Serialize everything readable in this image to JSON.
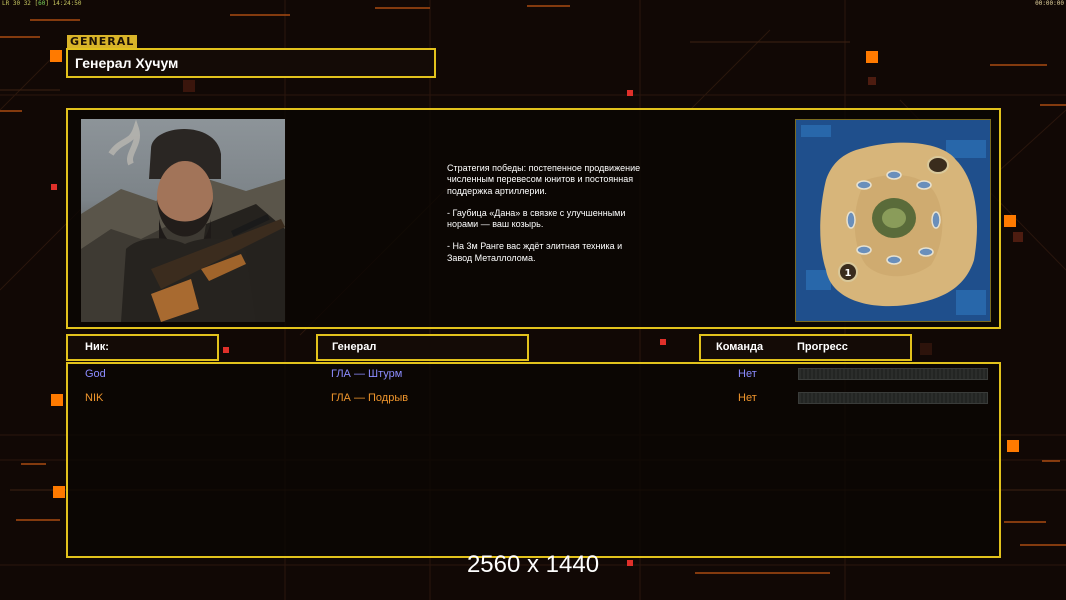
{
  "status_bar": {
    "left_prefix": "LR",
    "left_values": "30 32",
    "fps": "60",
    "clock": "14:24:50",
    "right_time": "00:00:00"
  },
  "general_tag": "GENERAL",
  "title": "Генерал Хучум",
  "briefing": {
    "paragraphs": [
      "Стратегия победы: постепенное продвижение численным перевесом юнитов и постоянная поддержка артиллерии.",
      "- Гаубица «Дана» в связке с улучшенными норами — ваш козырь.",
      "- На 3м Ранге вас ждёт элитная техника и Завод Металлолома."
    ]
  },
  "map": {
    "start_positions": [
      "1"
    ]
  },
  "headers": {
    "nick": "Ник:",
    "general": "Генерал",
    "team": "Команда",
    "progress": "Прогресс"
  },
  "players": [
    {
      "nick": "God",
      "general": "ГЛА — Штурм",
      "team": "Нет",
      "color": "#8c8cff",
      "progress": 0
    },
    {
      "nick": "NIK",
      "general": "ГЛА — Подрыв",
      "team": "Нет",
      "color": "#f0962d",
      "progress": 0
    }
  ],
  "resolution_label": "2560 x 1440",
  "colors": {
    "frame": "#e2c21c",
    "accent_orange": "#ff7a00",
    "background": "#110805"
  }
}
